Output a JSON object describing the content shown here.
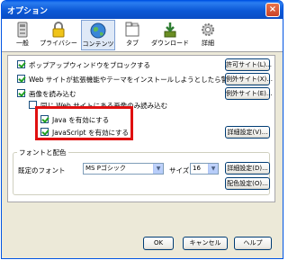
{
  "window": {
    "title": "オプション",
    "close_glyph": "×"
  },
  "tabs": [
    {
      "label": "一般",
      "icon": "switch-icon"
    },
    {
      "label": "プライバシー",
      "icon": "lock-icon"
    },
    {
      "label": "コンテンツ",
      "icon": "globe-icon",
      "selected": true
    },
    {
      "label": "タブ",
      "icon": "tabs-icon"
    },
    {
      "label": "ダウンロード",
      "icon": "download-icon"
    },
    {
      "label": "詳細",
      "icon": "gear-icon"
    }
  ],
  "content": {
    "popups": {
      "label": "ポップアップウィンドウをブロックする",
      "checked": true,
      "button": "許可サイト(L)..."
    },
    "themes": {
      "label": "Web サイトが拡張機能やテーマをインストールしようとしたら警告する",
      "checked": true,
      "button": "例外サイト(X)..."
    },
    "images": {
      "label": "画像を読み込む",
      "checked": true,
      "button": "例外サイト(E)..."
    },
    "images_orig": {
      "label": "同じ Web サイトにある画像のみ読み込む",
      "checked": false
    },
    "java": {
      "label": "Java を有効にする",
      "checked": true
    },
    "javascript": {
      "label": "JavaScript を有効にする",
      "checked": true,
      "button": "詳細設定(V)..."
    }
  },
  "fonts": {
    "group_title": "フォントと配色",
    "default_font_label": "既定のフォント",
    "default_font_value": "MS Pゴシック",
    "size_label": "サイズ",
    "size_value": "16",
    "advanced_button": "詳細設定(D)...",
    "colors_button": "配色設定(O)..."
  },
  "footer": {
    "ok": "OK",
    "cancel": "キャンセル",
    "help": "ヘルプ"
  },
  "colors": {
    "title_bar": "#0a58d6",
    "highlight": "#e01010",
    "check": "#21a121"
  }
}
